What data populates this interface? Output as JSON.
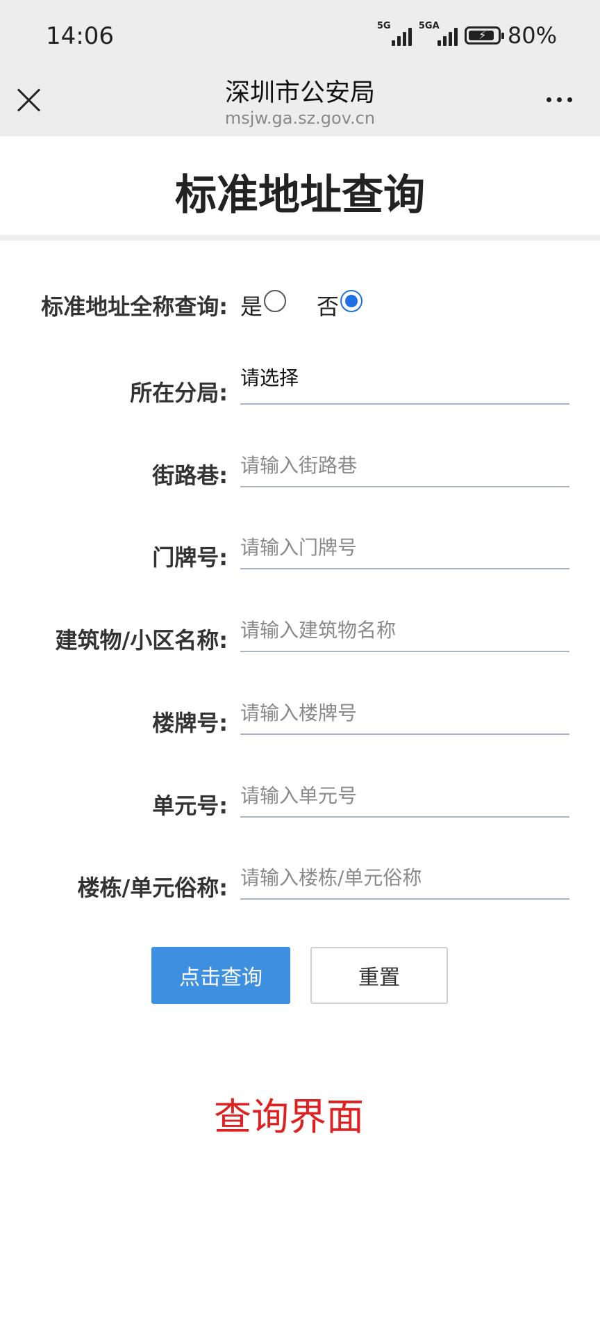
{
  "status_bar": {
    "time": "14:06",
    "signal1_label": "5G",
    "signal2_label": "5GA",
    "battery": "80%"
  },
  "nav": {
    "title": "深圳市公安局",
    "url": "msjw.ga.sz.gov.cn"
  },
  "page": {
    "title": "标准地址查询"
  },
  "radio": {
    "label": "标准地址全称查询:",
    "yes": "是",
    "no": "否",
    "selected": "否"
  },
  "fields": {
    "branch": {
      "label": "所在分局:",
      "value": "请选择"
    },
    "street": {
      "label": "街路巷:",
      "placeholder": "请输入街路巷"
    },
    "door": {
      "label": "门牌号:",
      "placeholder": "请输入门牌号"
    },
    "building": {
      "label": "建筑物/小区名称:",
      "placeholder": "请输入建筑物名称"
    },
    "block": {
      "label": "楼牌号:",
      "placeholder": "请输入楼牌号"
    },
    "unit": {
      "label": "单元号:",
      "placeholder": "请输入单元号"
    },
    "alias": {
      "label": "楼栋/单元俗称:",
      "placeholder": "请输入楼栋/单元俗称"
    }
  },
  "buttons": {
    "query": "点击查询",
    "reset": "重置"
  },
  "caption": "查询界面",
  "colors": {
    "accent": "#3d8fe0",
    "radio_selected": "#1f6fe5",
    "caption": "#e02020"
  }
}
